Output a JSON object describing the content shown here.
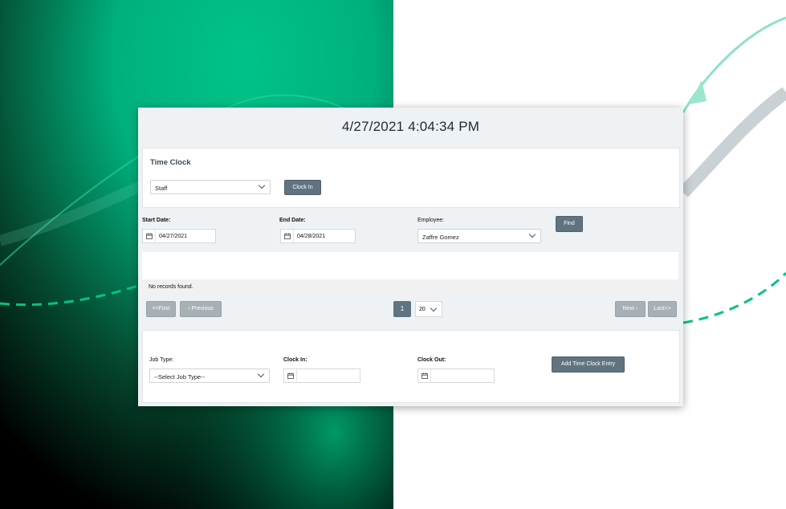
{
  "clock": {
    "datetime": "4/27/2021 4:04:34 PM"
  },
  "time_clock": {
    "title": "Time Clock",
    "role_select": "Staff",
    "clock_in_button": "Clock In"
  },
  "filters": {
    "start_date_label": "Start Date:",
    "start_date_value": "04/27/2021",
    "end_date_label": "End Date:",
    "end_date_value": "04/28/2021",
    "employee_label": "Employee:",
    "employee_value": "Zaffre Gomez",
    "find_button": "Find"
  },
  "records": {
    "empty_message": "No records found."
  },
  "pager": {
    "first": "<<First",
    "previous": "‹ Previous",
    "current_page": "1",
    "page_size": "20",
    "next": "Next ›",
    "last": "Last>>"
  },
  "entry": {
    "job_type_label": "Job Type:",
    "job_type_value": "--Select Job Type--",
    "clock_in_label": "Clock In:",
    "clock_out_label": "Clock Out:",
    "add_button": "Add Time Clock Entry"
  },
  "colors": {
    "accent_green": "#00c389",
    "button_slate": "#5f7480",
    "button_disabled": "#a7b0b5"
  }
}
